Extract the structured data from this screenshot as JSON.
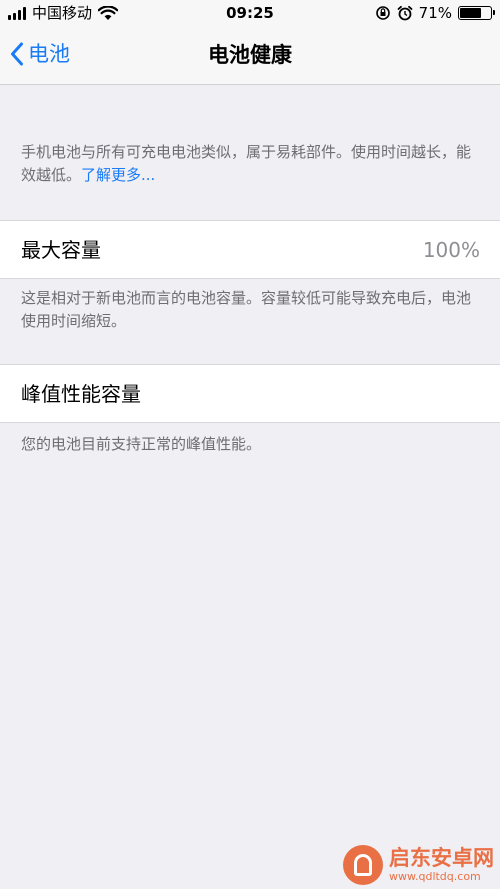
{
  "status_bar": {
    "carrier": "中国移动",
    "time": "09:25",
    "battery_percent": "71%",
    "battery_level": 0.71,
    "icons": [
      "signal-icon",
      "wifi-icon",
      "orientation-lock-icon",
      "alarm-icon",
      "battery-icon"
    ]
  },
  "nav": {
    "back_label": "电池",
    "back_icon": "chevron-left-icon",
    "title": "电池健康"
  },
  "intro": {
    "text": "手机电池与所有可充电电池类似，属于易耗部件。使用时间越长，能效越低。",
    "link": "了解更多..."
  },
  "max_capacity": {
    "label": "最大容量",
    "value": "100%",
    "footnote": "这是相对于新电池而言的电池容量。容量较低可能导致充电后，电池使用时间缩短。"
  },
  "peak_performance": {
    "label": "峰值性能容量",
    "footnote": "您的电池目前支持正常的峰值性能。"
  },
  "watermark": {
    "name": "启东安卓网",
    "url": "www.qdltdq.com"
  },
  "colors": {
    "accent": "#1a7bf6",
    "background": "#efeff4",
    "footnote": "#6d6d72",
    "value": "#8e8e93",
    "watermark": "#e96a3c"
  }
}
